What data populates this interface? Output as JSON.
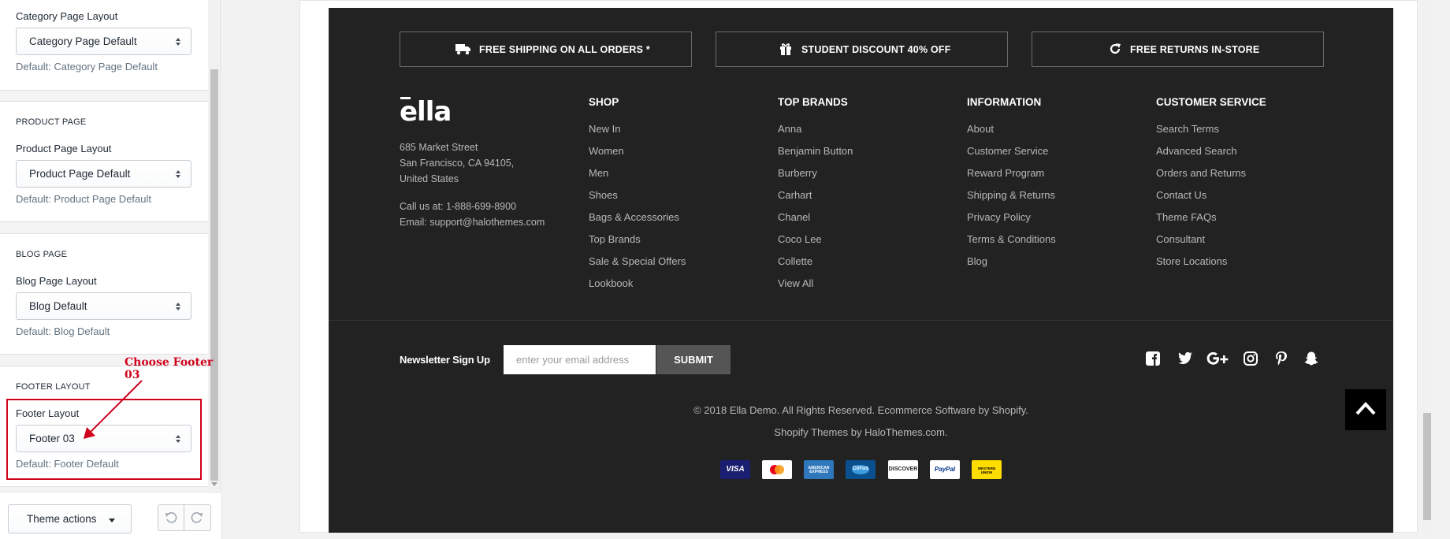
{
  "sidebar": {
    "category": {
      "field_label": "Category Page Layout",
      "selected": "Category Page Default",
      "help": "Default: Category Page Default"
    },
    "product": {
      "heading": "PRODUCT PAGE",
      "field_label": "Product Page Layout",
      "selected": "Product Page Default",
      "help": "Default: Product Page Default"
    },
    "blog": {
      "heading": "BLOG PAGE",
      "field_label": "Blog Page Layout",
      "selected": "Blog Default",
      "help": "Default: Blog Default"
    },
    "footer": {
      "heading": "FOOTER LAYOUT",
      "field_label": "Footer Layout",
      "selected": "Footer 03",
      "help": "Default: Footer Default"
    },
    "annotation": "Choose Footer 03",
    "annotation_color": "#d0021b",
    "theme_actions_label": "Theme actions"
  },
  "promos": [
    {
      "icon": "truck-icon",
      "label": "FREE SHIPPING ON ALL ORDERS *"
    },
    {
      "icon": "gift-icon",
      "label": "STUDENT DISCOUNT 40% OFF"
    },
    {
      "icon": "refresh-icon",
      "label": "FREE RETURNS IN-STORE"
    }
  ],
  "brand": {
    "logo": "ella",
    "address": [
      "685 Market Street",
      "San Francisco, CA 94105,",
      "United States"
    ],
    "phone": "Call us at: 1-888-699-8900",
    "email": "Email: support@halothemes.com"
  },
  "columns": [
    {
      "title": "SHOP",
      "links": [
        "New In",
        "Women",
        "Men",
        "Shoes",
        "Bags & Accessories",
        "Top Brands",
        "Sale & Special Offers",
        "Lookbook"
      ]
    },
    {
      "title": "TOP BRANDS",
      "links": [
        "Anna",
        "Benjamin Button",
        "Burberry",
        "Carhart",
        "Chanel",
        "Coco Lee",
        "Collette",
        "View All"
      ]
    },
    {
      "title": "INFORMATION",
      "links": [
        "About",
        "Customer Service",
        "Reward Program",
        "Shipping & Returns",
        "Privacy Policy",
        "Terms & Conditions",
        "Blog"
      ]
    },
    {
      "title": "CUSTOMER SERVICE",
      "links": [
        "Search Terms",
        "Advanced Search",
        "Orders and Returns",
        "Contact Us",
        "Theme FAQs",
        "Consultant",
        "Store Locations"
      ]
    }
  ],
  "newsletter": {
    "label": "Newsletter Sign Up",
    "placeholder": "enter your email address",
    "submit": "SUBMIT"
  },
  "social_icons": [
    "facebook-icon",
    "twitter-icon",
    "google-plus-icon",
    "instagram-icon",
    "pinterest-icon",
    "snapchat-icon"
  ],
  "copyright": {
    "line1": "© 2018 Ella Demo. All Rights Reserved. Ecommerce Software by Shopify.",
    "line2": "Shopify Themes by HaloThemes.com."
  },
  "payments": [
    {
      "name": "VISA",
      "bg": "#1a1f71",
      "fg": "#ffffff"
    },
    {
      "name": "mastercard",
      "bg": "#ffffff",
      "fg": "#eb001b"
    },
    {
      "name": "AMERICAN EXPRESS",
      "bg": "#2e77bb",
      "fg": "#ffffff"
    },
    {
      "name": "Cirrus",
      "bg": "#0a4f8e",
      "fg": "#ffffff"
    },
    {
      "name": "DISCOVER",
      "bg": "#ffffff",
      "fg": "#222222"
    },
    {
      "name": "PayPal",
      "bg": "#ffffff",
      "fg": "#003087"
    },
    {
      "name": "WESTERN UNION",
      "bg": "#ffdd00",
      "fg": "#000000"
    }
  ],
  "colors": {
    "footer_bg": "#222222",
    "footer_text": "#b8b8b8",
    "accent_red": "#d0021b"
  }
}
